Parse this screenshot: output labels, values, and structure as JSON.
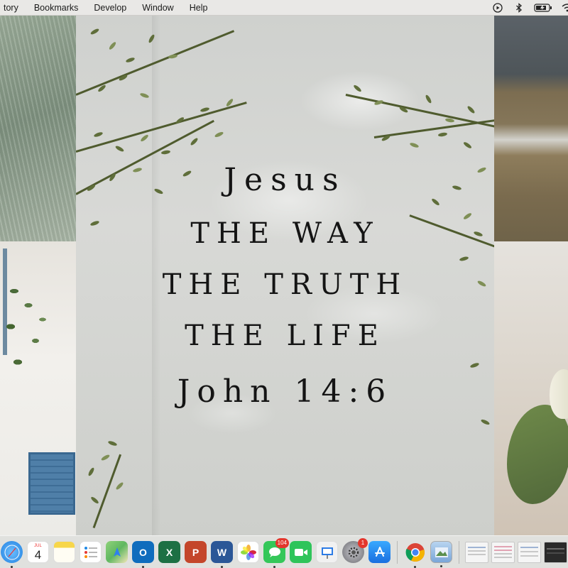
{
  "menubar": {
    "items": [
      "tory",
      "Bookmarks",
      "Develop",
      "Window",
      "Help"
    ],
    "status_icons": [
      "play-circle-icon",
      "bluetooth-icon",
      "battery-charging-icon",
      "wifi-icon"
    ]
  },
  "wallpaper": {
    "quote": {
      "line1": "Jesus",
      "line2": "THE WAY",
      "line3": "THE TRUTH",
      "line4": "THE LIFE",
      "reference": "John 14:6"
    }
  },
  "dock": {
    "apps": [
      {
        "name": "safari-icon",
        "color": "#1f8ef1"
      },
      {
        "name": "calendar-icon",
        "month": "JUL",
        "day": "4"
      },
      {
        "name": "notes-icon",
        "color": "#f7d64a"
      },
      {
        "name": "reminders-icon",
        "color": "#ffffff"
      },
      {
        "name": "maps-icon",
        "color": "#5fb760"
      },
      {
        "name": "outlook-icon",
        "color": "#0f6cbd",
        "letter": "O"
      },
      {
        "name": "excel-icon",
        "color": "#1d7044",
        "letter": "X"
      },
      {
        "name": "powerpoint-icon",
        "color": "#c4462a",
        "letter": "P"
      },
      {
        "name": "word-icon",
        "color": "#2b5797",
        "letter": "W"
      },
      {
        "name": "photos-icon",
        "color": "#f3f3f3"
      },
      {
        "name": "messages-icon",
        "color": "#34c759",
        "badge": "104"
      },
      {
        "name": "facetime-icon",
        "color": "#2ec45a"
      },
      {
        "name": "keynote-icon",
        "color": "#f1f1f1"
      },
      {
        "name": "system-preferences-icon",
        "color": "#8e8e93",
        "badge": "1"
      },
      {
        "name": "app-store-icon",
        "color": "#1a8cf0"
      },
      {
        "name": "chrome-icon",
        "color": "#ffffff"
      },
      {
        "name": "preview-icon",
        "color": "#7aa6d8"
      }
    ],
    "thumbnails": 4
  }
}
